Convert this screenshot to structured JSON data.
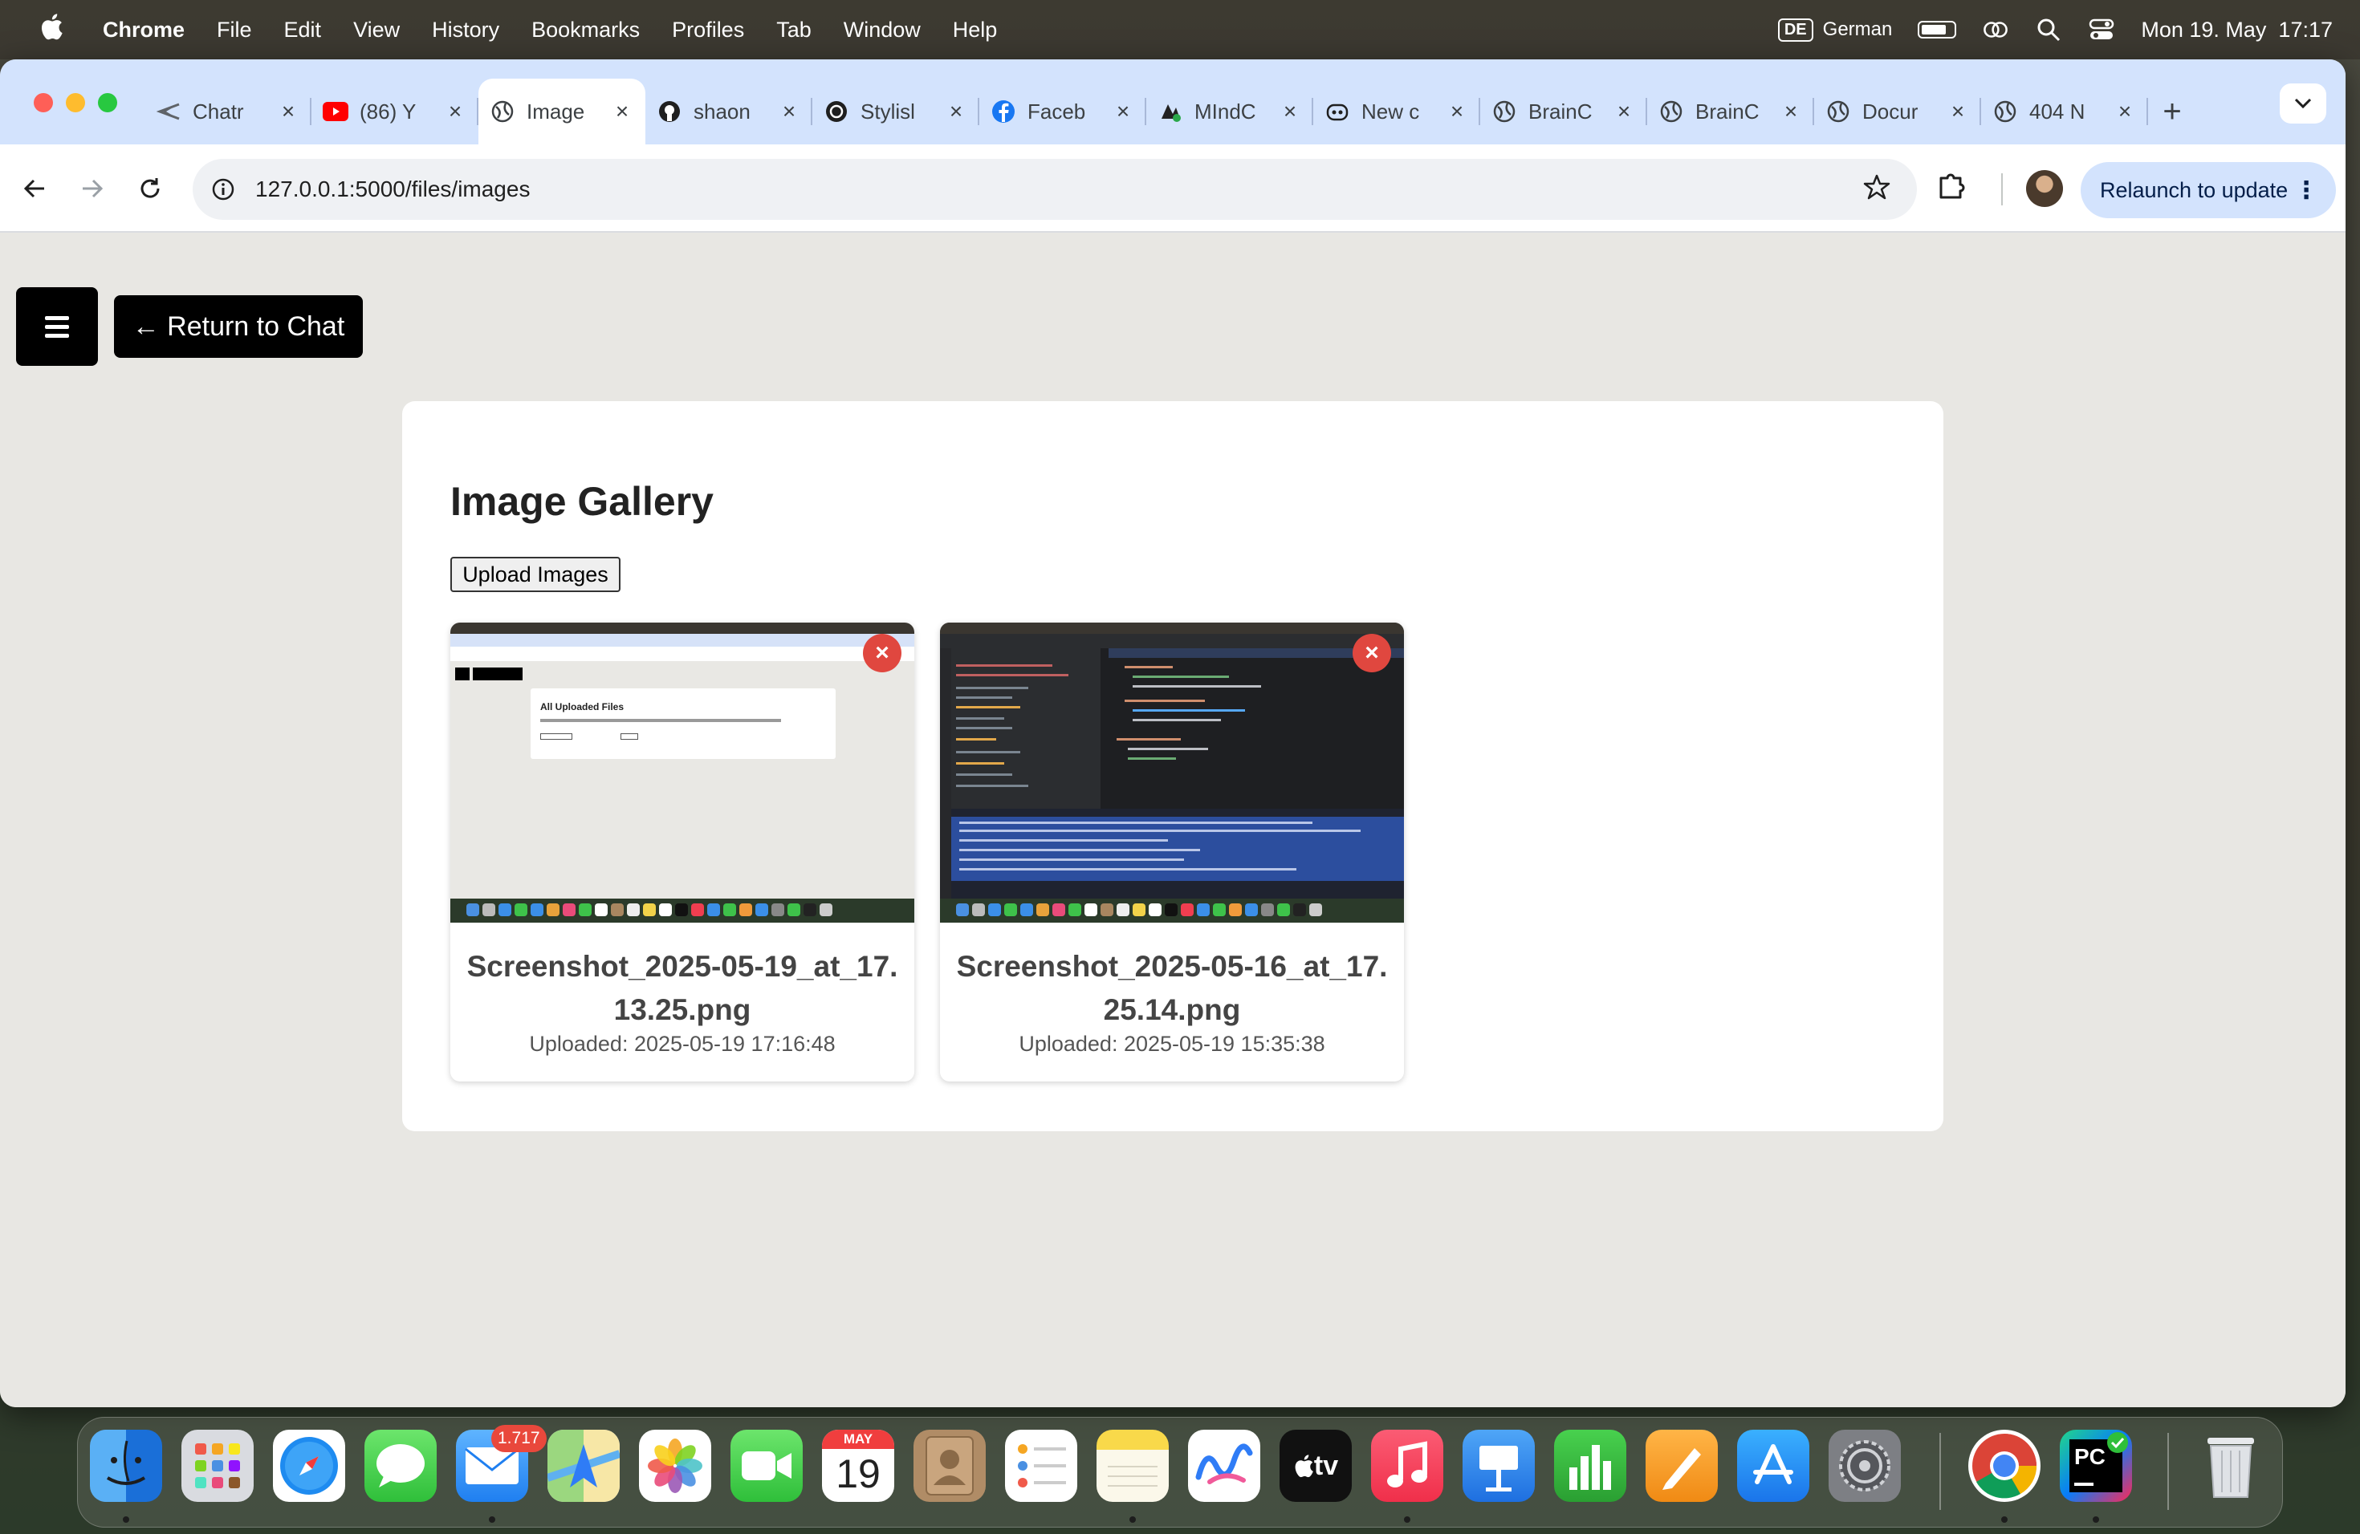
{
  "menubar": {
    "app": "Chrome",
    "items": [
      "File",
      "Edit",
      "View",
      "History",
      "Bookmarks",
      "Profiles",
      "Tab",
      "Window",
      "Help"
    ],
    "keyboard_badge": "DE",
    "keyboard_label": "German",
    "datetime": "Mon 19. May  17:17"
  },
  "tabs": [
    {
      "title": "Chatr",
      "icon": "chatgpt-icon"
    },
    {
      "title": "(86) Y",
      "icon": "youtube-icon"
    },
    {
      "title": "Image",
      "icon": "globe-icon",
      "active": true
    },
    {
      "title": "shaon",
      "icon": "github-icon"
    },
    {
      "title": "Stylisl",
      "icon": "openai-icon"
    },
    {
      "title": "Faceb",
      "icon": "facebook-icon"
    },
    {
      "title": "MIndC",
      "icon": "mind-icon"
    },
    {
      "title": "New c",
      "icon": "copilot-icon"
    },
    {
      "title": "BrainC",
      "icon": "globe-icon"
    },
    {
      "title": "BrainC",
      "icon": "globe-icon"
    },
    {
      "title": "Docur",
      "icon": "globe-icon"
    },
    {
      "title": "404 N",
      "icon": "globe-icon"
    }
  ],
  "toolbar": {
    "url": "127.0.0.1:5000/files/images",
    "relaunch_label": "Relaunch to update"
  },
  "page": {
    "return_label": "← Return to Chat",
    "title": "Image Gallery",
    "upload_label": "Upload Images",
    "delete_label": "×",
    "images": [
      {
        "filename": "Screenshot_2025-05-19_at_17.13.25.png",
        "uploaded": "Uploaded: 2025-05-19 17:16:48"
      },
      {
        "filename": "Screenshot_2025-05-16_at_17.25.14.png",
        "uploaded": "Uploaded: 2025-05-19 15:35:38"
      }
    ],
    "thumb1_heading": "All Uploaded Files"
  },
  "dock": {
    "mail_badge": "1.717",
    "calendar_month": "MAY",
    "calendar_day": "19",
    "tv_label": "tv",
    "pycharm_label": "PC"
  },
  "colors": {
    "accent_blue": "#d3e3fd",
    "delete_red": "#e0473f",
    "button_black": "#000000"
  }
}
